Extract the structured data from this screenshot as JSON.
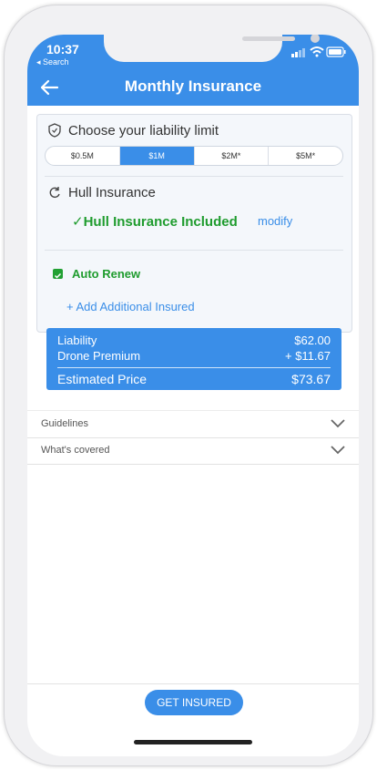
{
  "status_bar": {
    "time": "10:37",
    "back_app": "◂ Search"
  },
  "nav": {
    "title": "Monthly Insurance"
  },
  "liability": {
    "title": "Choose your liability limit",
    "options": [
      "$0.5M",
      "$1M",
      "$2M*",
      "$5M*"
    ],
    "selected": "$1M"
  },
  "hull": {
    "title": "Hull Insurance",
    "status": "✓Hull Insurance Included",
    "modify_label": "modify"
  },
  "auto_renew": {
    "label": "Auto Renew",
    "checked": true
  },
  "add_insured": {
    "label": "+ Add Additional Insured"
  },
  "price": {
    "liability_label": "Liability",
    "liability_value": "$62.00",
    "drone_label": "Drone Premium",
    "drone_value": "+ $11.67",
    "total_label": "Estimated Price",
    "total_value": "$73.67"
  },
  "accordion": [
    {
      "label": "Guidelines"
    },
    {
      "label": "What's covered"
    }
  ],
  "cta": {
    "label": "GET INSURED"
  },
  "colors": {
    "accent": "#3a8ee8",
    "success": "#1f9c2e"
  }
}
